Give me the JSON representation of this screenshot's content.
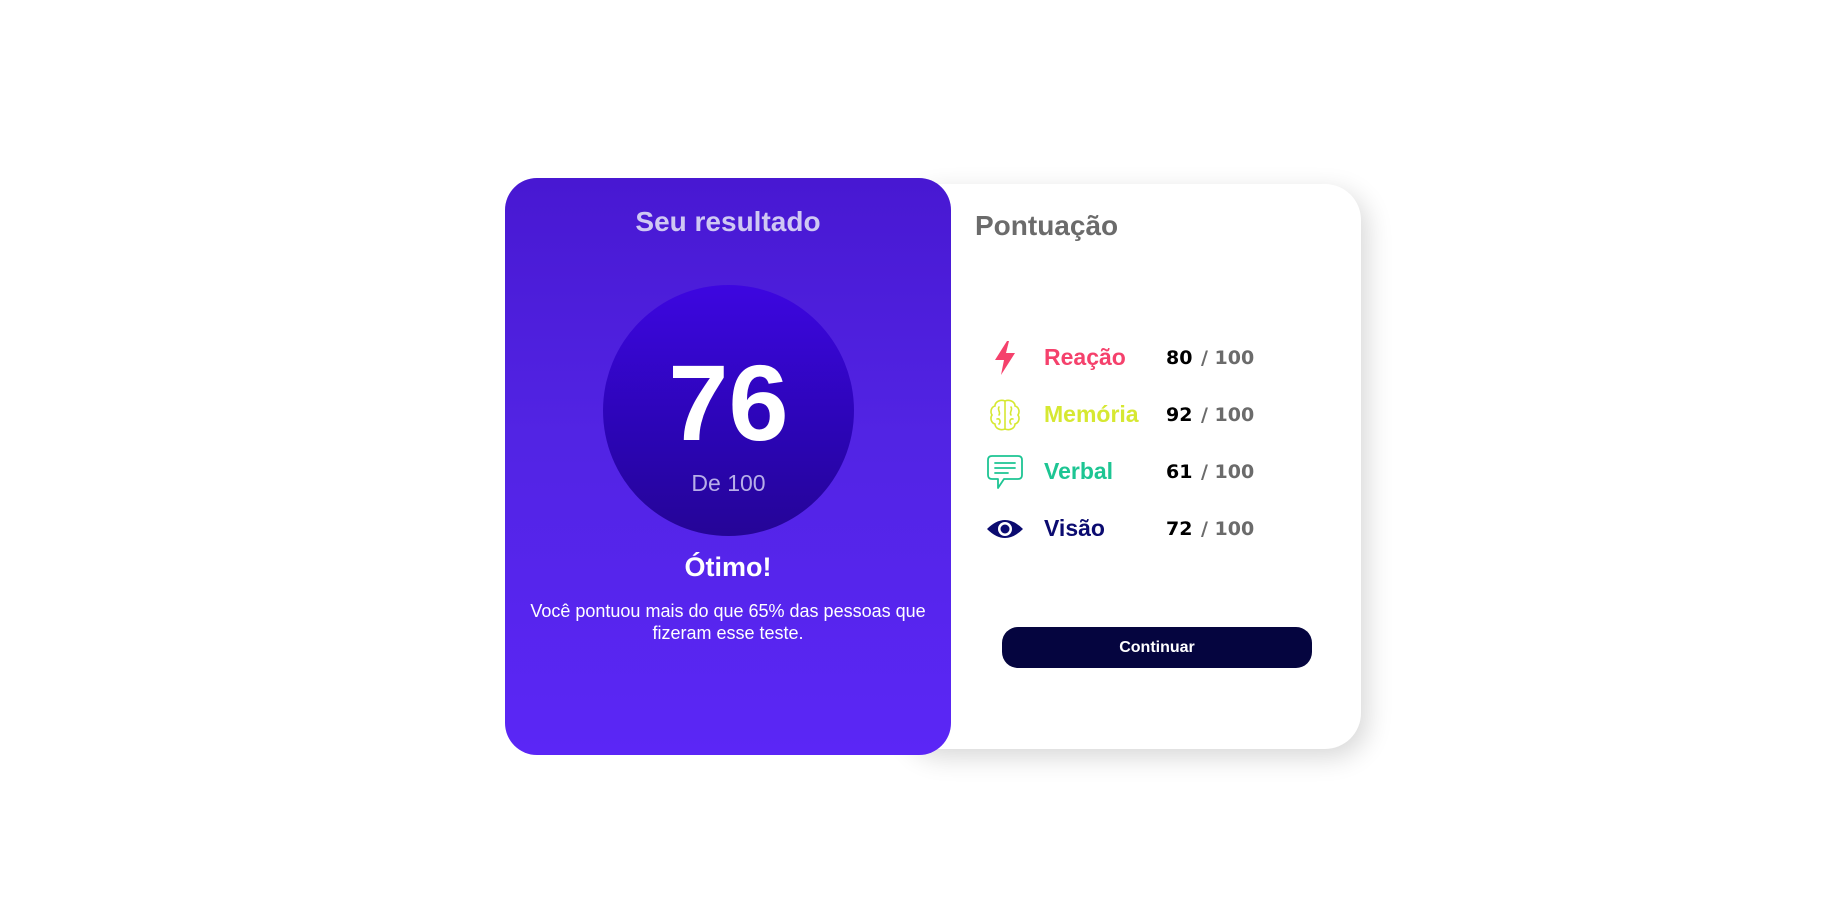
{
  "result": {
    "title": "Seu resultado",
    "score": "76",
    "score_of": "De 100",
    "grade": "Ótimo!",
    "message": "Você pontuou mais do que 65% das pessoas que fizeram esse teste."
  },
  "summary": {
    "title": "Pontuação",
    "items": [
      {
        "label": "Reação",
        "score": "80",
        "total": "/ 100",
        "color": "#f5416c",
        "icon": "lightning-icon"
      },
      {
        "label": "Memória",
        "score": "92",
        "total": "/ 100",
        "color": "#d6e832",
        "icon": "brain-icon"
      },
      {
        "label": "Verbal",
        "score": "61",
        "total": "/ 100",
        "color": "#1dc593",
        "icon": "chat-bubble-icon"
      },
      {
        "label": "Visão",
        "score": "72",
        "total": "/ 100",
        "color": "#0b0b70",
        "icon": "eye-icon"
      }
    ],
    "button_label": "Continuar"
  },
  "colors": {
    "result_gradient_top": "#4818d2",
    "result_gradient_bottom": "#5b26f6",
    "button_bg": "#05053f"
  }
}
